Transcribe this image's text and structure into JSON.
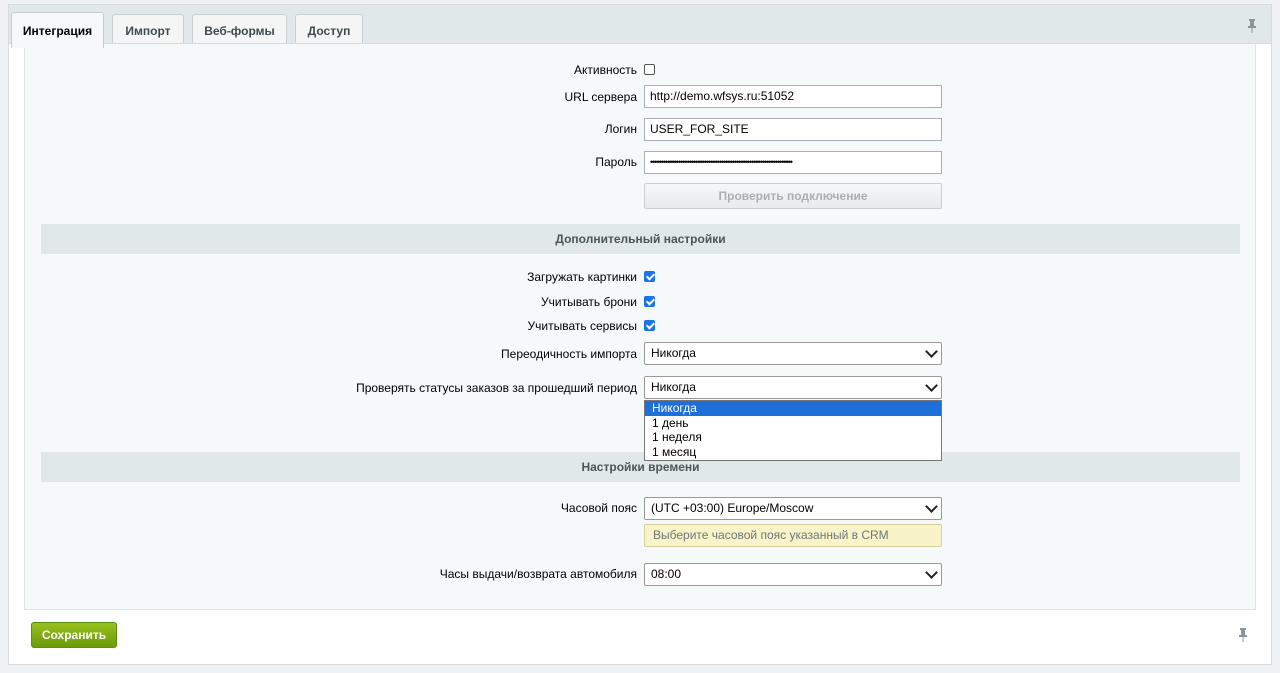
{
  "tabs": [
    "Интеграция",
    "Импорт",
    "Веб-формы",
    "Доступ"
  ],
  "main": {
    "activity_label": "Активность",
    "url_label": "URL сервера",
    "url_value": "http://demo.wfsys.ru:51052",
    "login_label": "Логин",
    "login_value": "USER_FOR_SITE",
    "password_label": "Пароль",
    "password_value": "••••••••••••••••••••••••••••••••••••••••••••••••••••••••••••••••••",
    "check_button": "Проверить подключение"
  },
  "extra": {
    "title": "Дополнительный настройки",
    "load_images_label": "Загружать картинки",
    "bookings_label": "Учитывать брони",
    "services_label": "Учитывать сервисы",
    "import_freq_label": "Переодичность импорта",
    "import_freq_value": "Никогда",
    "check_status_label": "Проверять статусы заказов за прошедший период",
    "check_status_value": "Никогда",
    "options": [
      "Никогда",
      "1 день",
      "1 неделя",
      "1 месяц"
    ]
  },
  "time": {
    "title": "Настройки времени",
    "tz_label": "Часовой пояс",
    "tz_value": "(UTC +03:00) Europe/Moscow",
    "tz_hint": "Выберите часовой пояс указанный в CRM",
    "hours_label": "Часы выдачи/возврата автомобиля",
    "hours_value": "08:00"
  },
  "footer": {
    "save_label": "Сохранить"
  },
  "colors": {
    "accent": "#1e6fd9",
    "save_button": "#7eab12"
  }
}
